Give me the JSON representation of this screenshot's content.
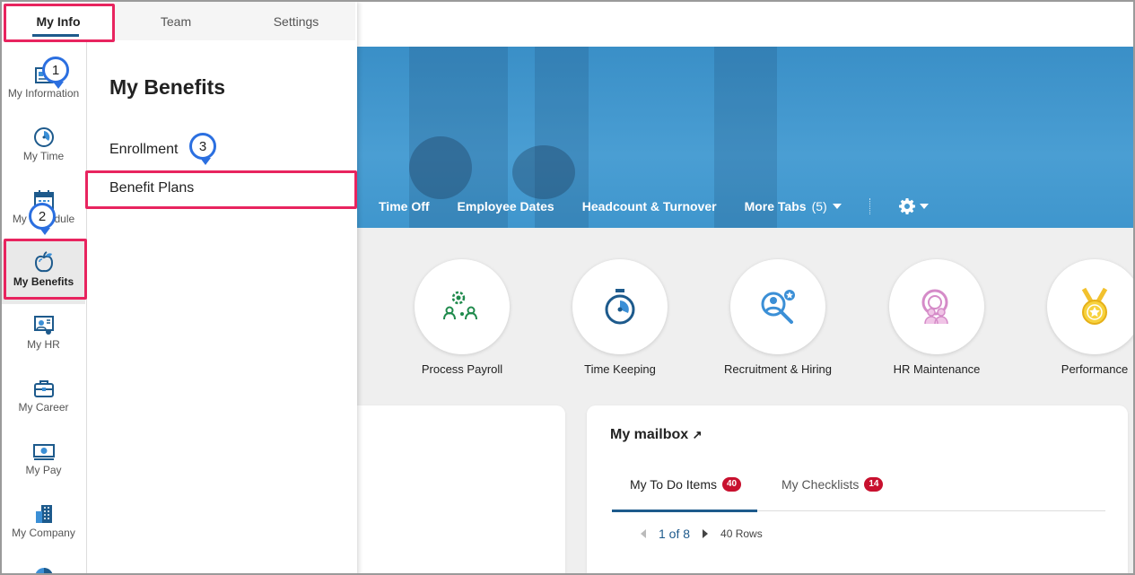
{
  "panel": {
    "tabs": [
      "My Info",
      "Team",
      "Settings"
    ],
    "rail": [
      {
        "label": "My Information",
        "icon": "id-card-icon"
      },
      {
        "label": "My Time",
        "icon": "clock-icon"
      },
      {
        "label": "My Schedule",
        "icon": "calendar-icon"
      },
      {
        "label": "My Benefits",
        "icon": "apple-icon"
      },
      {
        "label": "My HR",
        "icon": "person-board-icon"
      },
      {
        "label": "My Career",
        "icon": "briefcase-icon"
      },
      {
        "label": "My Pay",
        "icon": "money-icon"
      },
      {
        "label": "My Company",
        "icon": "building-icon"
      }
    ],
    "menu_title": "My Benefits",
    "menu_items": [
      "Enrollment",
      "Benefit Plans"
    ]
  },
  "callouts": [
    "1",
    "2",
    "3"
  ],
  "hero": {
    "tabs": [
      "Time Off",
      "Employee Dates",
      "Headcount & Turnover"
    ],
    "more_tabs": "More Tabs",
    "more_count": "(5)"
  },
  "tiles": [
    "Process Payroll",
    "Time Keeping",
    "Recruitment & Hiring",
    "HR Maintenance",
    "Performance"
  ],
  "mailbox": {
    "title": "My mailbox",
    "tabs": [
      {
        "label": "My To Do Items",
        "count": "40"
      },
      {
        "label": "My Checklists",
        "count": "14"
      }
    ],
    "pager": {
      "page": "1 of 8",
      "rows": "40 Rows"
    }
  },
  "colors": {
    "accent": "#1d5a8c",
    "highlight": "#e8245f",
    "callout": "#2b6fe0",
    "hero": "#4a9ed3"
  }
}
